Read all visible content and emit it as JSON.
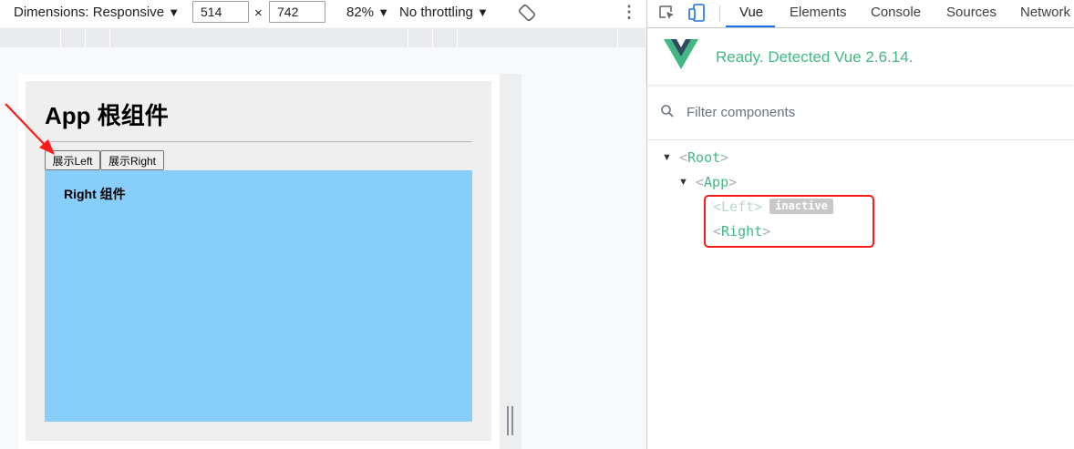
{
  "device_toolbar": {
    "dimensions_label": "Dimensions: Responsive",
    "width_value": "514",
    "times_symbol": "×",
    "height_value": "742",
    "zoom_label": "82%",
    "throttling_label": "No throttling",
    "dropdown_glyph": "▼",
    "more_glyph": "⋮"
  },
  "app": {
    "title": "App 根组件",
    "show_left_button": "展示Left",
    "show_right_button": "展示Right",
    "right_component_title": "Right 组件",
    "colors": {
      "right_panel": "#87cefa",
      "app_background": "#efefef"
    }
  },
  "devtools": {
    "tabs": [
      "Vue",
      "Elements",
      "Console",
      "Sources",
      "Network"
    ],
    "active_tab": "Vue",
    "vue_status": "Ready. Detected Vue 2.6.14.",
    "filter_placeholder": "Filter components",
    "tree": {
      "root": "Root",
      "app": "App",
      "left": "Left",
      "left_badge": "inactive",
      "right": "Right",
      "lt": "<",
      "gt": ">",
      "expanded_glyph": "▼"
    },
    "colors": {
      "vue_green": "#42b983",
      "highlight": "#ff1a1a",
      "accent": "#1a73e8"
    }
  }
}
